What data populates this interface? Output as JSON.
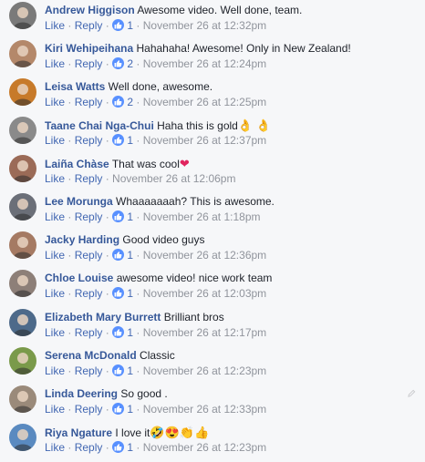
{
  "actions": {
    "like": "Like",
    "reply": "Reply",
    "sep": " · "
  },
  "colors": {
    "author": "#365899",
    "link": "#4267b2",
    "meta": "#90949c",
    "like_badge": "#5890ff",
    "heart": "#e0245e"
  },
  "comments": [
    {
      "author": "Andrew Higgison",
      "text": "Awesome video. Well done, team.",
      "likes": "1",
      "time": "November 26 at 12:32pm",
      "avatar_color": "#7a7a7a"
    },
    {
      "author": "Kiri Wehipeihana",
      "text": "Hahahaha! Awesome! Only in New Zealand!",
      "likes": "2",
      "time": "November 26 at 12:24pm",
      "avatar_color": "#b4886a"
    },
    {
      "author": "Leisa Watts",
      "text": "Well done, awesome.",
      "likes": "2",
      "time": "November 26 at 12:25pm",
      "avatar_color": "#c77a2a"
    },
    {
      "author": "Taane Chai Nga-Chui",
      "text": "Haha this is gold",
      "emoji": "👌 👌",
      "likes": "1",
      "time": "November 26 at 12:37pm",
      "avatar_color": "#8a8a8a"
    },
    {
      "author": "Laiña Chàse",
      "text": "That was cool",
      "emoji": "❤",
      "likes": "",
      "time": "November 26 at 12:06pm",
      "avatar_color": "#9b6b57"
    },
    {
      "author": "Lee Morunga",
      "text": "Whaaaaaaah? This is awesome.",
      "likes": "1",
      "time": "November 26 at 1:18pm",
      "avatar_color": "#6b6f78"
    },
    {
      "author": "Jacky Harding",
      "text": "Good video guys",
      "likes": "1",
      "time": "November 26 at 12:36pm",
      "avatar_color": "#a57a63"
    },
    {
      "author": "Chloe Louise",
      "text": "awesome video! nice work team",
      "likes": "1",
      "time": "November 26 at 12:03pm",
      "avatar_color": "#8d7f78"
    },
    {
      "author": "Elizabeth Mary Burrett",
      "text": "Brilliant bros",
      "likes": "1",
      "time": "November 26 at 12:17pm",
      "avatar_color": "#4d6a8a"
    },
    {
      "author": "Serena McDonald",
      "text": "Classic",
      "likes": "1",
      "time": "November 26 at 12:23pm",
      "avatar_color": "#7a9a4a"
    },
    {
      "author": "Linda Deering",
      "text": "So good .",
      "likes": "1",
      "time": "November 26 at 12:33pm",
      "avatar_color": "#9a8a7a"
    },
    {
      "author": "Riya Ngature",
      "text": "I love it",
      "emoji": "🤣😍👏👍",
      "likes": "1",
      "time": "November 26 at 12:23pm",
      "avatar_color": "#5a8ac0"
    }
  ]
}
